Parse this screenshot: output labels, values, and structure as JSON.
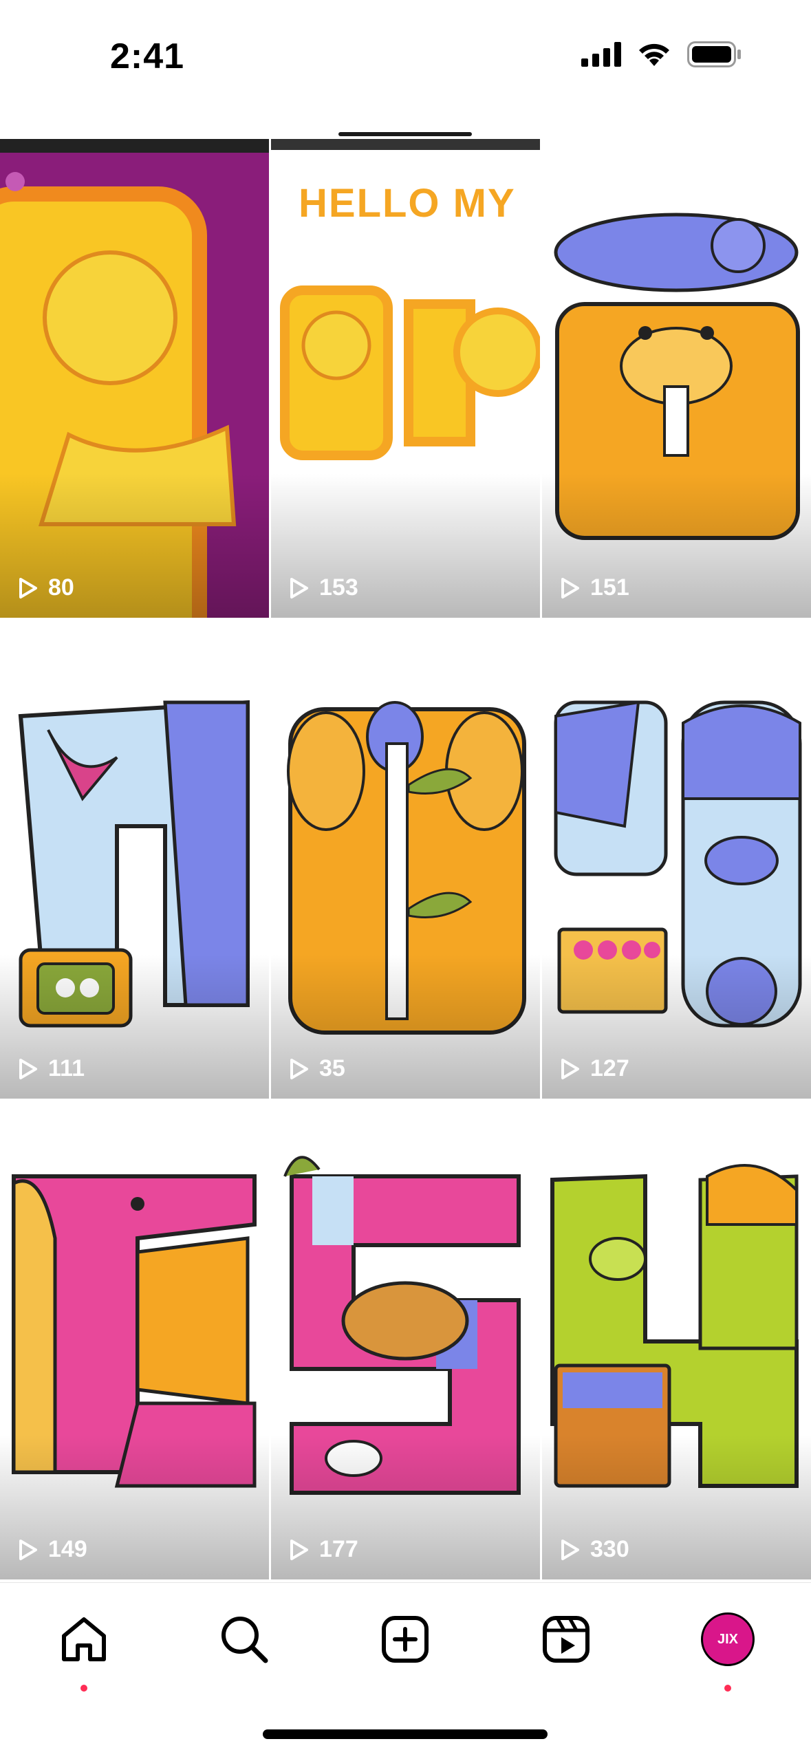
{
  "status_bar": {
    "time": "2:41",
    "icons": [
      "cellular-signal-icon",
      "wifi-icon",
      "battery-icon"
    ]
  },
  "grid": {
    "posts": [
      {
        "views": "80",
        "art": "jix-photoshop-letter-L-art",
        "text": "",
        "color": "#8a1d7a"
      },
      {
        "views": "153",
        "art": "hello-my-name-lettering-art",
        "text": "HELLO MY",
        "color": "#f5a623"
      },
      {
        "views": "151",
        "art": "mouse-and-lion-letter-art",
        "text": "",
        "color": "#f5a623"
      },
      {
        "views": "111",
        "art": "shark-letter-art",
        "text": "",
        "color": "#7b85e8"
      },
      {
        "views": "35",
        "art": "bear-bamboo-letter-art",
        "text": "",
        "color": "#f5a623"
      },
      {
        "views": "127",
        "art": "gorilla-letter-art",
        "text": "",
        "color": "#7b85e8"
      },
      {
        "views": "149",
        "art": "dragon-letter-art",
        "text": "",
        "color": "#e8489a"
      },
      {
        "views": "177",
        "art": "snakes-letter-art",
        "text": "",
        "color": "#e8489a"
      },
      {
        "views": "330",
        "art": "camel-letter-art",
        "text": "",
        "color": "#b4d12e"
      }
    ]
  },
  "tab_bar": {
    "items": [
      "home-icon",
      "search-icon",
      "create-icon",
      "reels-icon",
      "profile-avatar"
    ],
    "avatar_text": "JIX"
  },
  "colors": {
    "accent_dot": "#ff2d55",
    "text": "#000000"
  }
}
